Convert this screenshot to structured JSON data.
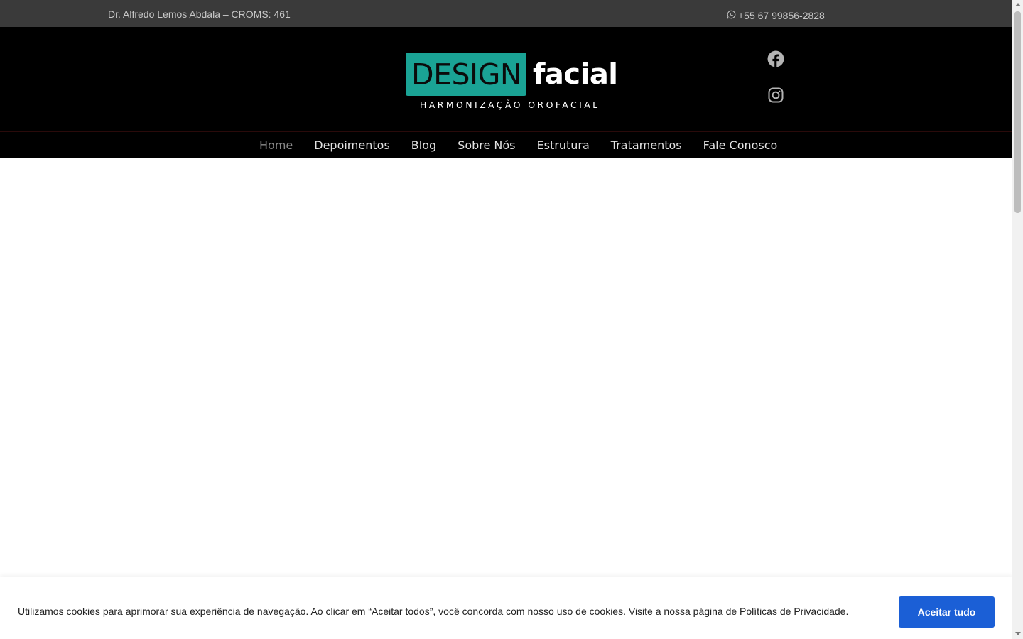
{
  "topbar": {
    "doctor": "Dr. Alfredo Lemos Abdala – CROMS: 461",
    "phone": "+55 67 99856-2828",
    "phone_icon": "whatsapp-icon"
  },
  "header": {
    "logo": {
      "word1": "DESIGN",
      "word2": "facial",
      "tagline": "HARMONIZAÇÃO OROFACIAL"
    },
    "social": [
      {
        "icon": "facebook-icon"
      },
      {
        "icon": "instagram-icon"
      }
    ]
  },
  "nav": {
    "items": [
      {
        "label": "Home",
        "active": true
      },
      {
        "label": "Depoimentos"
      },
      {
        "label": "Blog"
      },
      {
        "label": "Sobre Nós"
      },
      {
        "label": "Estrutura"
      },
      {
        "label": "Tratamentos"
      },
      {
        "label": "Fale Conosco"
      }
    ]
  },
  "cookie_banner": {
    "message": "Utilizamos cookies para aprimorar sua experiência de navegação. Ao clicar em “Aceitar todos”, você concorda com nosso uso de cookies. Visite a nossa página de Políticas de Privacidade.",
    "accept_label": "Aceitar tudo"
  },
  "colors": {
    "brand_teal": "#1aa395",
    "topbar_bg": "#3a3a3a",
    "header_bg": "#000000",
    "button_blue": "#1b5fd6"
  }
}
